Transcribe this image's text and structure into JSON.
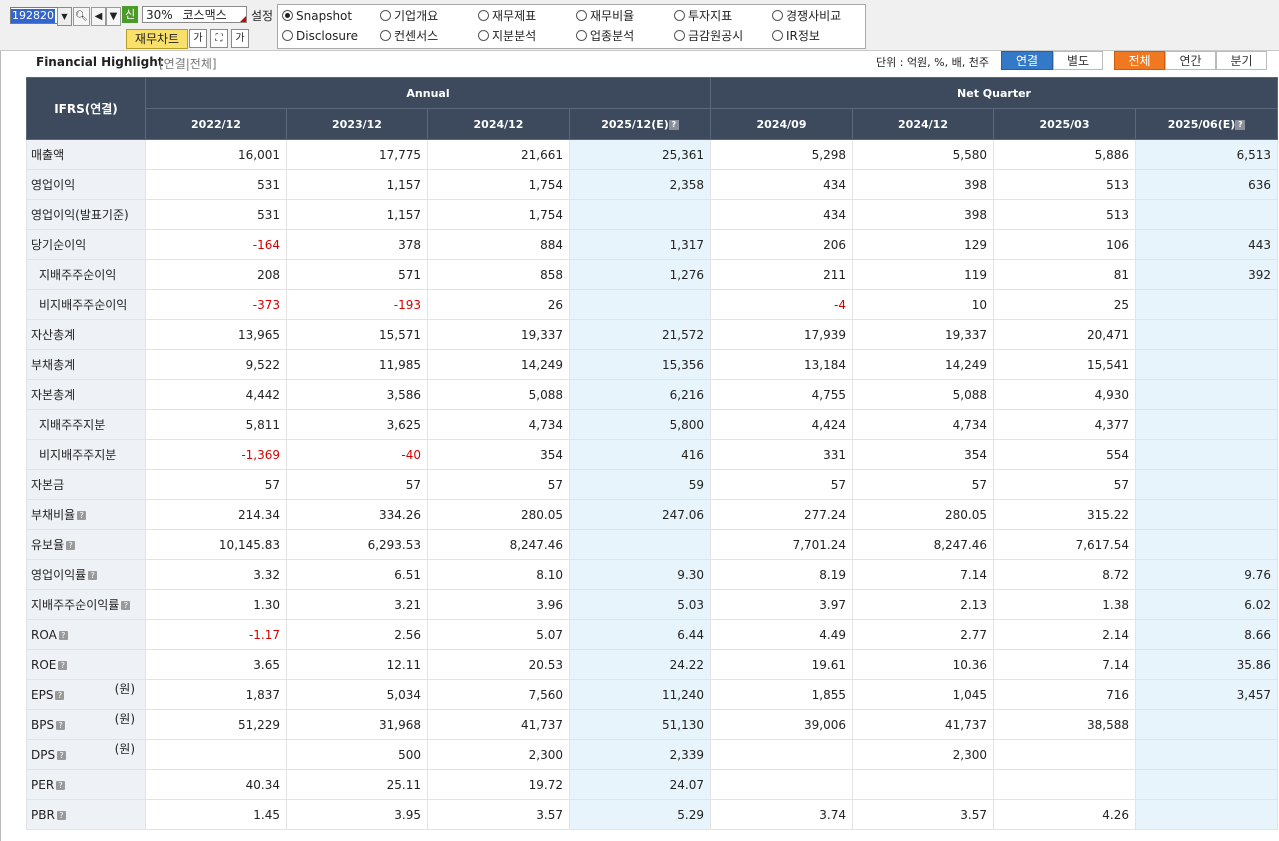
{
  "toolbar": {
    "stock_code": "192820",
    "dropdown_icon": "chevron-down-icon",
    "sin_label": "신",
    "zoom_label": "30%",
    "stock_name": "코스맥스",
    "settings_label": "설정",
    "chart_button": "재무차트",
    "font_btn_1": "가",
    "font_btn_2": "가"
  },
  "radios": [
    {
      "label": "Snapshot",
      "selected": true
    },
    {
      "label": "기업개요",
      "selected": false
    },
    {
      "label": "재무제표",
      "selected": false
    },
    {
      "label": "재무비율",
      "selected": false
    },
    {
      "label": "투자지표",
      "selected": false
    },
    {
      "label": "경쟁사비교",
      "selected": false
    },
    {
      "label": "Disclosure",
      "selected": false
    },
    {
      "label": "컨센서스",
      "selected": false
    },
    {
      "label": "지분분석",
      "selected": false
    },
    {
      "label": "업종분석",
      "selected": false
    },
    {
      "label": "금감원공시",
      "selected": false
    },
    {
      "label": "IR정보",
      "selected": false
    }
  ],
  "header": {
    "title": "Financial Highlight",
    "subtitle": "[연결|전체]",
    "unit": "단위 : 억원, %, 배, 천주",
    "seg_consolidated": "연결",
    "seg_separate": "별도",
    "seg_all": "전체",
    "seg_annual": "연간",
    "seg_quarter": "분기"
  },
  "table": {
    "corner": "IFRS(연결)",
    "group_annual": "Annual",
    "group_quarter": "Net Quarter",
    "columns": [
      "2022/12",
      "2023/12",
      "2024/12",
      "2025/12(E)",
      "2024/09",
      "2024/12",
      "2025/03",
      "2025/06(E)"
    ],
    "rows": [
      {
        "label": "매출액",
        "indent": false,
        "help": false,
        "unit": "",
        "values": [
          "16,001",
          "17,775",
          "21,661",
          "25,361",
          "5,298",
          "5,580",
          "5,886",
          "6,513"
        ]
      },
      {
        "label": "영업이익",
        "indent": false,
        "help": false,
        "unit": "",
        "values": [
          "531",
          "1,157",
          "1,754",
          "2,358",
          "434",
          "398",
          "513",
          "636"
        ]
      },
      {
        "label": "영업이익(발표기준)",
        "indent": false,
        "help": false,
        "unit": "",
        "values": [
          "531",
          "1,157",
          "1,754",
          "",
          "434",
          "398",
          "513",
          ""
        ]
      },
      {
        "label": "당기순이익",
        "indent": false,
        "help": false,
        "unit": "",
        "values": [
          "-164",
          "378",
          "884",
          "1,317",
          "206",
          "129",
          "106",
          "443"
        ]
      },
      {
        "label": "지배주주순이익",
        "indent": true,
        "help": false,
        "unit": "",
        "values": [
          "208",
          "571",
          "858",
          "1,276",
          "211",
          "119",
          "81",
          "392"
        ]
      },
      {
        "label": "비지배주주순이익",
        "indent": true,
        "help": false,
        "unit": "",
        "values": [
          "-373",
          "-193",
          "26",
          "",
          "-4",
          "10",
          "25",
          ""
        ]
      },
      {
        "label": "자산총계",
        "indent": false,
        "help": false,
        "unit": "",
        "values": [
          "13,965",
          "15,571",
          "19,337",
          "21,572",
          "17,939",
          "19,337",
          "20,471",
          ""
        ]
      },
      {
        "label": "부채총계",
        "indent": false,
        "help": false,
        "unit": "",
        "values": [
          "9,522",
          "11,985",
          "14,249",
          "15,356",
          "13,184",
          "14,249",
          "15,541",
          ""
        ]
      },
      {
        "label": "자본총계",
        "indent": false,
        "help": false,
        "unit": "",
        "values": [
          "4,442",
          "3,586",
          "5,088",
          "6,216",
          "4,755",
          "5,088",
          "4,930",
          ""
        ]
      },
      {
        "label": "지배주주지분",
        "indent": true,
        "help": false,
        "unit": "",
        "values": [
          "5,811",
          "3,625",
          "4,734",
          "5,800",
          "4,424",
          "4,734",
          "4,377",
          ""
        ]
      },
      {
        "label": "비지배주주지분",
        "indent": true,
        "help": false,
        "unit": "",
        "values": [
          "-1,369",
          "-40",
          "354",
          "416",
          "331",
          "354",
          "554",
          ""
        ]
      },
      {
        "label": "자본금",
        "indent": false,
        "help": false,
        "unit": "",
        "values": [
          "57",
          "57",
          "57",
          "59",
          "57",
          "57",
          "57",
          ""
        ]
      },
      {
        "label": "부채비율",
        "indent": false,
        "help": true,
        "unit": "",
        "values": [
          "214.34",
          "334.26",
          "280.05",
          "247.06",
          "277.24",
          "280.05",
          "315.22",
          ""
        ]
      },
      {
        "label": "유보율",
        "indent": false,
        "help": true,
        "unit": "",
        "values": [
          "10,145.83",
          "6,293.53",
          "8,247.46",
          "",
          "7,701.24",
          "8,247.46",
          "7,617.54",
          ""
        ]
      },
      {
        "label": "영업이익률",
        "indent": false,
        "help": true,
        "unit": "",
        "values": [
          "3.32",
          "6.51",
          "8.10",
          "9.30",
          "8.19",
          "7.14",
          "8.72",
          "9.76"
        ]
      },
      {
        "label": "지배주주순이익률",
        "indent": false,
        "help": true,
        "unit": "",
        "values": [
          "1.30",
          "3.21",
          "3.96",
          "5.03",
          "3.97",
          "2.13",
          "1.38",
          "6.02"
        ]
      },
      {
        "label": "ROA",
        "indent": false,
        "help": true,
        "unit": "",
        "values": [
          "-1.17",
          "2.56",
          "5.07",
          "6.44",
          "4.49",
          "2.77",
          "2.14",
          "8.66"
        ]
      },
      {
        "label": "ROE",
        "indent": false,
        "help": true,
        "unit": "",
        "values": [
          "3.65",
          "12.11",
          "20.53",
          "24.22",
          "19.61",
          "10.36",
          "7.14",
          "35.86"
        ]
      },
      {
        "label": "EPS",
        "indent": false,
        "help": true,
        "unit": "(원)",
        "values": [
          "1,837",
          "5,034",
          "7,560",
          "11,240",
          "1,855",
          "1,045",
          "716",
          "3,457"
        ]
      },
      {
        "label": "BPS",
        "indent": false,
        "help": true,
        "unit": "(원)",
        "values": [
          "51,229",
          "31,968",
          "41,737",
          "51,130",
          "39,006",
          "41,737",
          "38,588",
          ""
        ]
      },
      {
        "label": "DPS",
        "indent": false,
        "help": true,
        "unit": "(원)",
        "values": [
          "",
          "500",
          "2,300",
          "2,339",
          "",
          "2,300",
          "",
          ""
        ]
      },
      {
        "label": "PER",
        "indent": false,
        "help": true,
        "unit": "",
        "values": [
          "40.34",
          "25.11",
          "19.72",
          "24.07",
          "",
          "",
          "",
          ""
        ]
      },
      {
        "label": "PBR",
        "indent": false,
        "help": true,
        "unit": "",
        "values": [
          "1.45",
          "3.95",
          "3.57",
          "5.29",
          "3.74",
          "3.57",
          "4.26",
          ""
        ]
      }
    ]
  },
  "colors": {
    "header_bg": "#3d4a5d",
    "estimate_bg": "#e8f4fb",
    "negative": "#d40000",
    "accent_blue": "#3478c8",
    "accent_orange": "#f07820"
  }
}
